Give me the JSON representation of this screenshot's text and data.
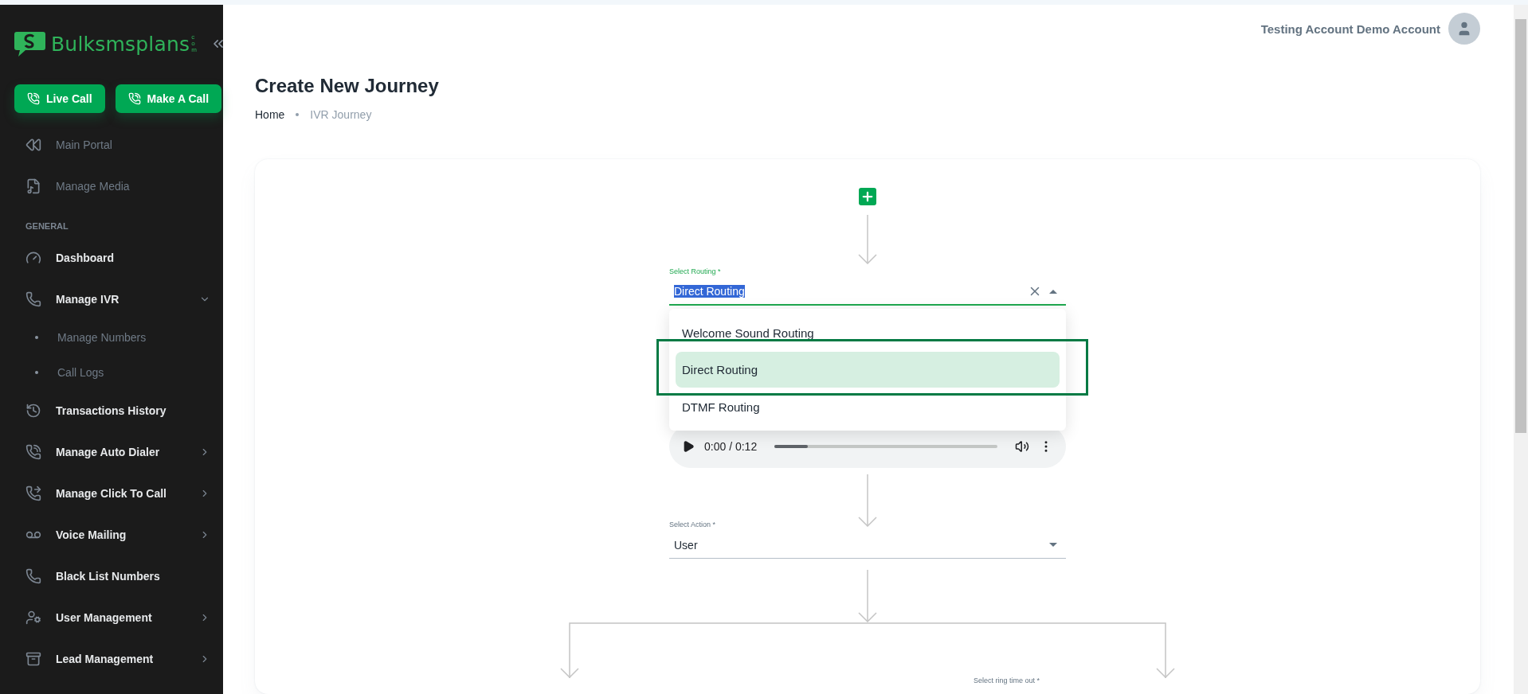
{
  "sidebar": {
    "logo": {
      "name": "Bulksmsplans",
      "suffix": "com"
    },
    "actions": [
      {
        "label": "Live Call"
      },
      {
        "label": "Make A Call"
      }
    ],
    "items": [
      {
        "kind": "link",
        "label": "Main Portal"
      },
      {
        "kind": "link",
        "label": "Manage Media"
      },
      {
        "kind": "section",
        "label": "GENERAL"
      },
      {
        "kind": "item",
        "label": "Dashboard",
        "has_submenu": false
      },
      {
        "kind": "item",
        "label": "Manage IVR",
        "has_submenu": true,
        "expanded": true,
        "children": [
          {
            "label": "Manage Numbers"
          },
          {
            "label": "Call Logs"
          }
        ]
      },
      {
        "kind": "item",
        "label": "Transactions History",
        "has_submenu": false
      },
      {
        "kind": "item",
        "label": "Manage Auto Dialer",
        "has_submenu": true,
        "expanded": false
      },
      {
        "kind": "item",
        "label": "Manage Click To Call",
        "has_submenu": true,
        "expanded": false
      },
      {
        "kind": "item",
        "label": "Voice Mailing",
        "has_submenu": true,
        "expanded": false
      },
      {
        "kind": "item",
        "label": "Black List Numbers",
        "has_submenu": false
      },
      {
        "kind": "item",
        "label": "User Management",
        "has_submenu": true,
        "expanded": false
      },
      {
        "kind": "item",
        "label": "Lead Management",
        "has_submenu": true,
        "expanded": false
      }
    ]
  },
  "header": {
    "user": "Testing Account Demo Account"
  },
  "page": {
    "title": "Create New Journey",
    "breadcrumbs": [
      {
        "label": "Home",
        "current": false
      },
      {
        "label": "IVR Journey",
        "current": true
      }
    ]
  },
  "journey": {
    "routing": {
      "label": "Select Routing *",
      "value": "Direct Routing",
      "text_selected": true,
      "open": true,
      "options": [
        {
          "label": "Welcome Sound Routing",
          "selected": false,
          "framed": false
        },
        {
          "label": "Direct Routing",
          "selected": true,
          "framed": true
        },
        {
          "label": "DTMF Routing",
          "selected": false,
          "framed": false
        }
      ]
    },
    "audio": {
      "time": "0:00 / 0:12",
      "level": 0.15
    },
    "action": {
      "label": "Select Action *",
      "value": "User"
    },
    "ring_timeout": {
      "label": "Select ring time out *"
    }
  }
}
